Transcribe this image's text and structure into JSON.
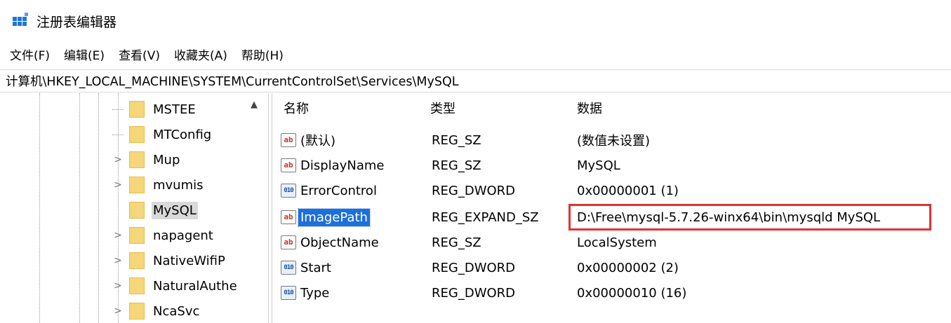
{
  "window": {
    "title": "注册表编辑器",
    "icon": "registry-editor-icon"
  },
  "menu": [
    "文件(F)",
    "编辑(E)",
    "查看(V)",
    "收藏夹(A)",
    "帮助(H)"
  ],
  "address": "计算机\\HKEY_LOCAL_MACHINE\\SYSTEM\\CurrentControlSet\\Services\\MySQL",
  "tree": {
    "items": [
      {
        "label": "MSTEE",
        "expander": ""
      },
      {
        "label": "MTConfig",
        "expander": ""
      },
      {
        "label": "Mup",
        "expander": ">"
      },
      {
        "label": "mvumis",
        "expander": ">"
      },
      {
        "label": "MySQL",
        "expander": ""
      },
      {
        "label": "napagent",
        "expander": ">"
      },
      {
        "label": "NativeWifiP",
        "expander": ">"
      },
      {
        "label": "NaturalAuthe",
        "expander": ">"
      },
      {
        "label": "NcaSvc",
        "expander": ">"
      }
    ],
    "selected": "MySQL"
  },
  "list": {
    "headers": {
      "name": "名称",
      "type": "类型",
      "data": "数据"
    },
    "rows": [
      {
        "icon": "ab",
        "name": "(默认)",
        "type": "REG_SZ",
        "data": "(数值未设置)"
      },
      {
        "icon": "ab",
        "name": "DisplayName",
        "type": "REG_SZ",
        "data": "MySQL"
      },
      {
        "icon": "dword",
        "name": "ErrorControl",
        "type": "REG_DWORD",
        "data": "0x00000001 (1)"
      },
      {
        "icon": "ab",
        "name": "ImagePath",
        "type": "REG_EXPAND_SZ",
        "data": "D:\\Free\\mysql-5.7.26-winx64\\bin\\mysqld MySQL"
      },
      {
        "icon": "ab",
        "name": "ObjectName",
        "type": "REG_SZ",
        "data": "LocalSystem"
      },
      {
        "icon": "dword",
        "name": "Start",
        "type": "REG_DWORD",
        "data": "0x00000002 (2)"
      },
      {
        "icon": "dword",
        "name": "Type",
        "type": "REG_DWORD",
        "data": "0x00000010 (16)"
      }
    ],
    "selected": "ImagePath"
  },
  "colors": {
    "selection": "#1e6fd9",
    "highlight_box": "#e03232",
    "folder": "#f5d77a"
  }
}
